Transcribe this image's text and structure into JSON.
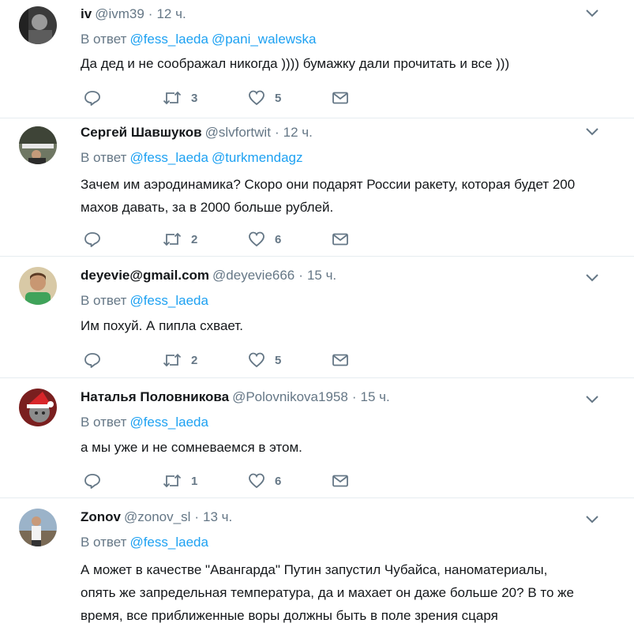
{
  "reply_prefix": "В ответ",
  "colors": {
    "link": "#1da1f2",
    "muted": "#657786",
    "text": "#14171a",
    "divider": "#e6ecf0"
  },
  "tweets": [
    {
      "fullname": "iv",
      "username": "@ivm39",
      "dot": "·",
      "time": "12 ч.",
      "mentions": [
        "@fess_laeda",
        "@pani_walewska"
      ],
      "text": "Да дед и не соображал никогда )))) бумажку дали прочитать и все )))",
      "retweets": "3",
      "likes": "5",
      "avatar_icon": "person-photo"
    },
    {
      "fullname": "Сергей Шавшуков",
      "username": "@slvfortwit",
      "dot": "·",
      "time": "12 ч.",
      "mentions": [
        "@fess_laeda",
        "@turkmendagz"
      ],
      "text": "Зачем им аэродинамика? Скоро они подарят России ракету, которая будет 200 махов давать, за в 2000 больше рублей.",
      "retweets": "2",
      "likes": "6",
      "avatar_icon": "crowd-photo"
    },
    {
      "fullname": "deyevie@gmail.com",
      "username": "@deyevie666",
      "dot": "·",
      "time": "15 ч.",
      "mentions": [
        "@fess_laeda"
      ],
      "text": "Им похуй. А пипла схвает.",
      "retweets": "2",
      "likes": "5",
      "avatar_icon": "person-photo"
    },
    {
      "fullname": "Наталья Половникова",
      "username": "@Polovnikova1958",
      "dot": "·",
      "time": "15 ч.",
      "mentions": [
        "@fess_laeda"
      ],
      "text": "а мы уже и не сомневаемся в этом.",
      "retweets": "1",
      "likes": "6",
      "avatar_icon": "cat-photo"
    },
    {
      "fullname": "Zonov",
      "username": "@zonov_sl",
      "dot": "·",
      "time": "13 ч.",
      "mentions": [
        "@fess_laeda"
      ],
      "text": "А может в качестве \"Авангарда\" Путин запустил Чубайса, наноматериалы, опять же запредельная температура, да и махает он даже больше 20? В то же время, все приближенные воры должны быть в поле зрения сцаря",
      "retweets": "",
      "likes": "",
      "avatar_icon": "person-photo"
    }
  ]
}
